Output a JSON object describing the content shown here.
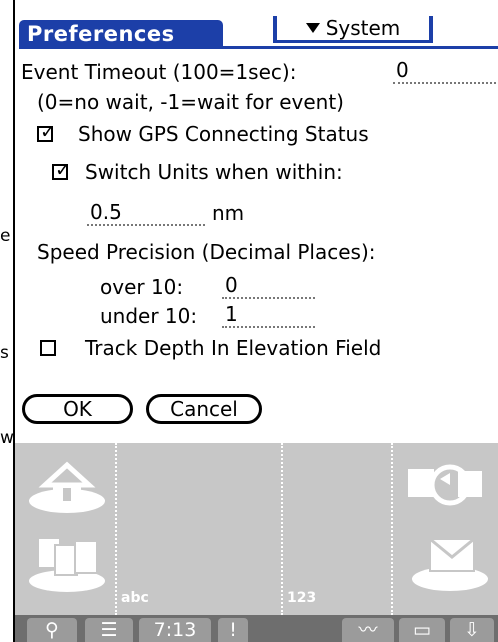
{
  "edge_clips": [
    "e",
    "s",
    "w"
  ],
  "title_bar": {
    "title": "Preferences",
    "category_label": "System"
  },
  "form": {
    "event_timeout_label": "Event Timeout (100=1sec):",
    "event_timeout_value": "0",
    "event_timeout_hint": "(0=no wait, -1=wait for event)",
    "show_gps_label": "Show GPS Connecting Status",
    "show_gps_checked": true,
    "switch_units_label": "Switch Units when within:",
    "switch_units_checked": true,
    "switch_units_value": "0.5",
    "switch_units_unit": "nm",
    "speed_precision_label": "Speed Precision (Decimal Places):",
    "over10_label": "over 10:",
    "over10_value": "0",
    "under10_label": "under 10:",
    "under10_value": "1",
    "track_depth_label": "Track Depth In Elevation Field",
    "track_depth_checked": false,
    "ok_label": "OK",
    "cancel_label": "Cancel"
  },
  "graffiti": {
    "abc_label": "abc",
    "num_label": "123",
    "icons": [
      "home-icon",
      "applications-icon",
      "find-sync-icon",
      "mail-icon"
    ]
  },
  "status_bar": {
    "time": "7:13",
    "icons": [
      "search-icon",
      "menu-icon",
      "alert-icon",
      "graffiti-icon",
      "keyboard-icon",
      "input-tray-icon"
    ]
  },
  "colors": {
    "title_blue": "#1c3fa8",
    "graffiti_gray": "#c7c7c7",
    "status_gray": "#6e6e6e"
  }
}
